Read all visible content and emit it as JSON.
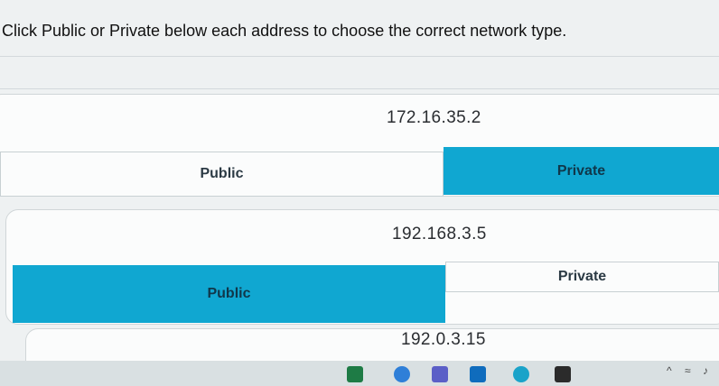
{
  "instruction": "Click Public or Private below each address to choose the correct network type.",
  "questions": [
    {
      "address": "172.16.35.2",
      "public_label": "Public",
      "private_label": "Private",
      "selected": "Private"
    },
    {
      "address": "192.168.3.5",
      "public_label": "Public",
      "private_label": "Private",
      "selected": "Public"
    },
    {
      "address": "192.0.3.15"
    }
  ],
  "taskbar": {
    "apps": [
      "excel-icon",
      "photos-icon",
      "teams-icon",
      "outlook-icon",
      "edge-icon",
      "store-icon"
    ],
    "tray": {
      "chevron": "^",
      "wifi": "wifi-icon",
      "volume": "volume-icon"
    }
  },
  "colors": {
    "selected": "#10a7d1",
    "page": "#eef1f2"
  }
}
